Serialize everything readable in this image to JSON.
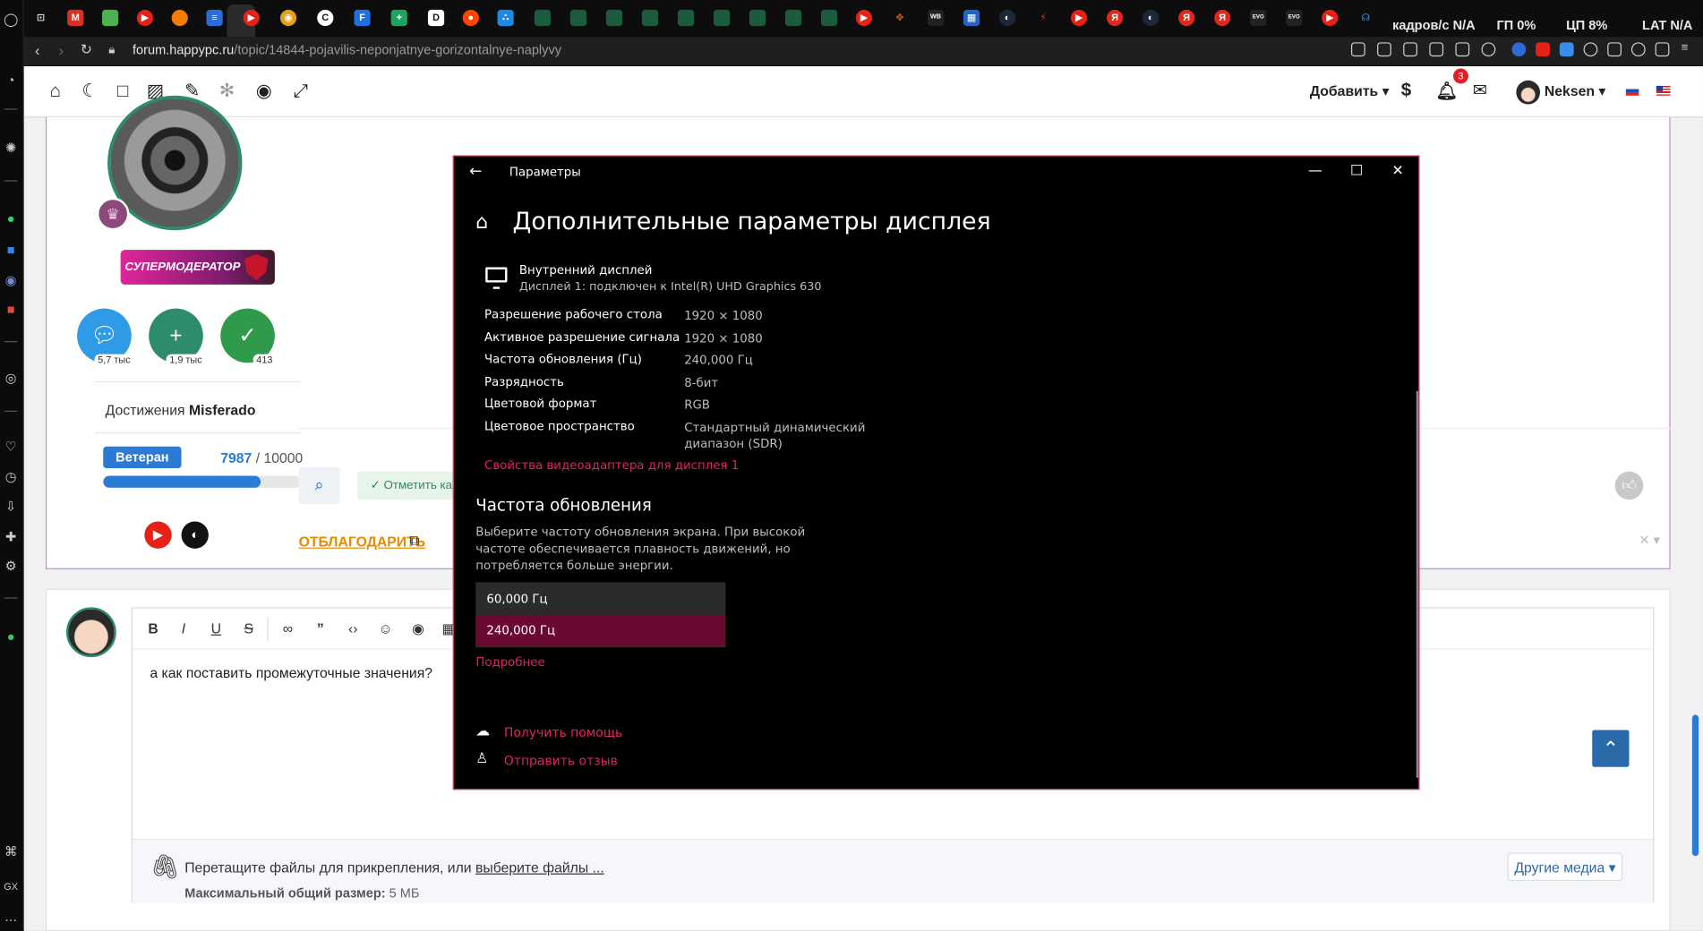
{
  "browser": {
    "url_host": "forum.happypc.ru",
    "url_path": "/topic/14844-pojavilis-neponjatnye-gorizontalnye-naplyvy",
    "hud": {
      "fps_label": "кадров/с",
      "fps_value": "N/A",
      "gpu_label": "ГП",
      "gpu_value": "0%",
      "cpu_label": "ЦП",
      "cpu_value": "8%",
      "lat_label": "LAT",
      "lat_value": "N/A"
    },
    "tab_icons": [
      "m-tab",
      "g-tab",
      "y-tab",
      "bird-tab",
      "chat-tab",
      "yt-tab",
      "sun-tab",
      "c-tab",
      "f-tab",
      "plus-tab",
      "d-tab",
      "reddit-tab",
      "dots-tab",
      "wt1",
      "wt2",
      "wt3",
      "wt4",
      "wt5",
      "wt6",
      "wt7",
      "wt8",
      "wt9",
      "yt2",
      "game-tab",
      "wb-tab",
      "grid-tab",
      "steam-tab",
      "bolt-tab",
      "yt3",
      "ya-tab",
      "steam2",
      "ya2",
      "ya3",
      "evo1",
      "evo2",
      "yt4",
      "hp-tab"
    ]
  },
  "site": {
    "add_label": "Добавить",
    "notif_count": "3",
    "username": "Neksen"
  },
  "post": {
    "badge_label": "СУПЕРМОДЕРАТОР",
    "stats": [
      {
        "count": "5,7 тыс",
        "icon": "chat-bubble-icon",
        "color": "#2f9be6"
      },
      {
        "count": "1,9 тыс",
        "icon": "plus-icon",
        "color": "#2e8b6e"
      },
      {
        "count": "413",
        "icon": "check-icon",
        "color": "#2e9a4a"
      }
    ],
    "achievements_label": "Достижения",
    "achievements_user": "Misferado",
    "rank_label": "Ветеран",
    "rank_current": "7987",
    "rank_sep": " / ",
    "rank_max": "10000",
    "rank_progress": 0.7987,
    "mark_label": "✓ Отметить как",
    "thanks_label": "ОТБЛАГОДАРИТЬ"
  },
  "reply": {
    "text": "а как поставить промежуточные значения?",
    "attach_prefix": "Перетащите файлы для прикрепления, или ",
    "attach_link": "выберите файлы ...",
    "limit_label": "Максимальный общий размер:",
    "limit_value": " 5 МБ",
    "media_label": "Другие медиа ▾"
  },
  "settings": {
    "window_title": "Параметры",
    "page_title": "Дополнительные параметры дисплея",
    "display_name": "Внутренний дисплей",
    "display_sub": "Дисплей 1: подключен к Intel(R) UHD Graphics 630",
    "rows": [
      {
        "key": "Разрешение рабочего стола",
        "value": "1920 × 1080"
      },
      {
        "key": "Активное разрешение сигнала",
        "value": "1920 × 1080"
      },
      {
        "key": "Частота обновления (Гц)",
        "value": "240,000 Гц"
      },
      {
        "key": "Разрядность",
        "value": "8-бит"
      },
      {
        "key": "Цветовой формат",
        "value": "RGB"
      },
      {
        "key": "Цветовое пространство",
        "value": "Стандартный динамический диапазон (SDR)"
      }
    ],
    "adapter_link": "Свойства видеоадаптера для дисплея 1",
    "refresh_heading": "Частота обновления",
    "refresh_desc": "Выберите частоту обновления экрана. При высокой частоте обеспечивается плавность движений, но потребляется больше энергии.",
    "refresh_options": [
      "60,000 Гц",
      "240,000 Гц"
    ],
    "refresh_selected": "240,000 Гц",
    "more_link": "Подробнее",
    "help_link": "Получить помощь",
    "feedback_link": "Отправить отзыв"
  }
}
